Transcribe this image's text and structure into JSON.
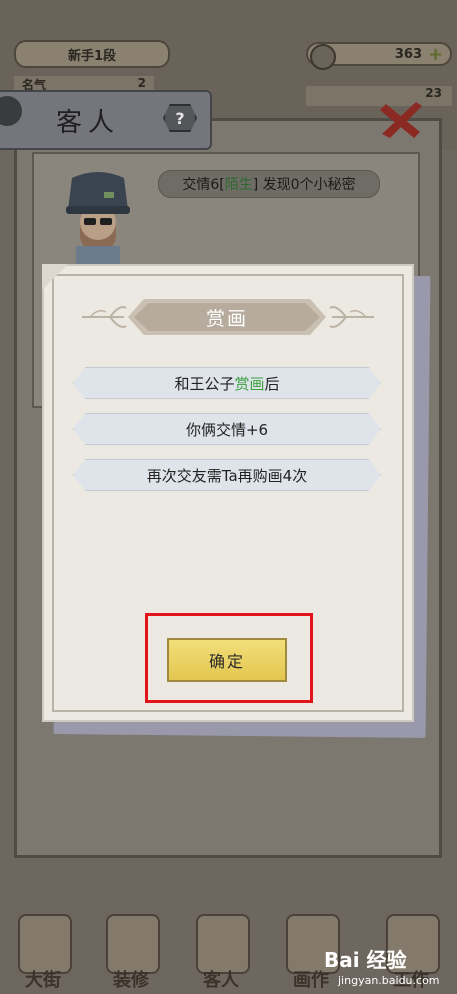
{
  "background": {
    "rank_label": "新手1段",
    "fame_label": "名气",
    "fame_value": "2",
    "coins": "363",
    "coins2": "23"
  },
  "guest_panel": {
    "title": "客人",
    "help_icon_text": "?",
    "friendship_prefix": "交情6[",
    "friendship_status": "陌生",
    "friendship_suffix": "] 发现0个小秘密"
  },
  "modal": {
    "title": "赏画",
    "rows": [
      {
        "prefix": "和王公子",
        "highlight": "赏画",
        "suffix": "后"
      },
      {
        "prefix": "你俩交情+6",
        "highlight": "",
        "suffix": ""
      },
      {
        "prefix": "再次交友需Ta再购画4次",
        "highlight": "",
        "suffix": ""
      }
    ],
    "confirm_label": "确定"
  },
  "bottom_nav": [
    {
      "label": "大街"
    },
    {
      "label": "装修"
    },
    {
      "label": "客人"
    },
    {
      "label": "画作"
    },
    {
      "label": "工作"
    }
  ],
  "watermark": {
    "text": "Bai 经验",
    "sub": "jingyan.baidu.com"
  },
  "colors": {
    "highlight_green": "#3aa13c",
    "annotation_red": "#e3141b",
    "button_gold": "#e3c64f"
  }
}
